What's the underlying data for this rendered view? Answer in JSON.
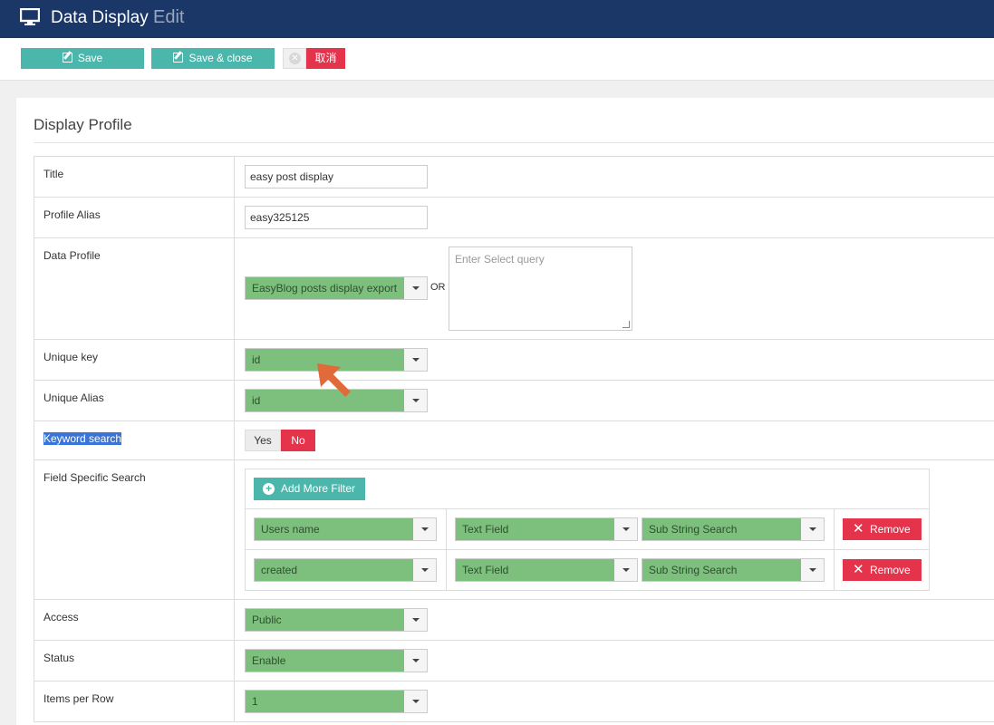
{
  "header": {
    "title": "Data Display",
    "subtitle": "Edit",
    "icon": "monitor-icon"
  },
  "toolbar": {
    "save_label": "Save",
    "save_close_label": "Save & close",
    "cancel_label": "取消"
  },
  "panel": {
    "title": "Display Profile"
  },
  "form": {
    "title": {
      "label": "Title",
      "value": "easy post display"
    },
    "alias": {
      "label": "Profile Alias",
      "value": "easy325125"
    },
    "data_profile": {
      "label": "Data Profile",
      "selected": "EasyBlog posts display export",
      "or_text": "OR",
      "query_placeholder": "Enter Select query"
    },
    "unique_key": {
      "label": "Unique key",
      "selected": "id"
    },
    "unique_alias": {
      "label": "Unique Alias",
      "selected": "id"
    },
    "keyword_search": {
      "label": "Keyword search",
      "yes": "Yes",
      "no": "No",
      "value": "No"
    },
    "field_search": {
      "label": "Field Specific Search",
      "add_label": "Add More Filter",
      "rows": [
        {
          "field": "Users name",
          "type": "Text Field",
          "mode": "Sub String Search",
          "remove": "Remove"
        },
        {
          "field": "created",
          "type": "Text Field",
          "mode": "Sub String Search",
          "remove": "Remove"
        }
      ]
    },
    "access": {
      "label": "Access",
      "selected": "Public"
    },
    "status": {
      "label": "Status",
      "selected": "Enable"
    },
    "items_per_row": {
      "label": "Items per Row",
      "selected": "1"
    }
  },
  "colors": {
    "header_bg": "#1b3768",
    "teal": "#4bb6ab",
    "red": "#e5334b",
    "green_select": "#7dbf7d",
    "arrow": "#e06a3a",
    "highlight": "#3a74d6"
  }
}
